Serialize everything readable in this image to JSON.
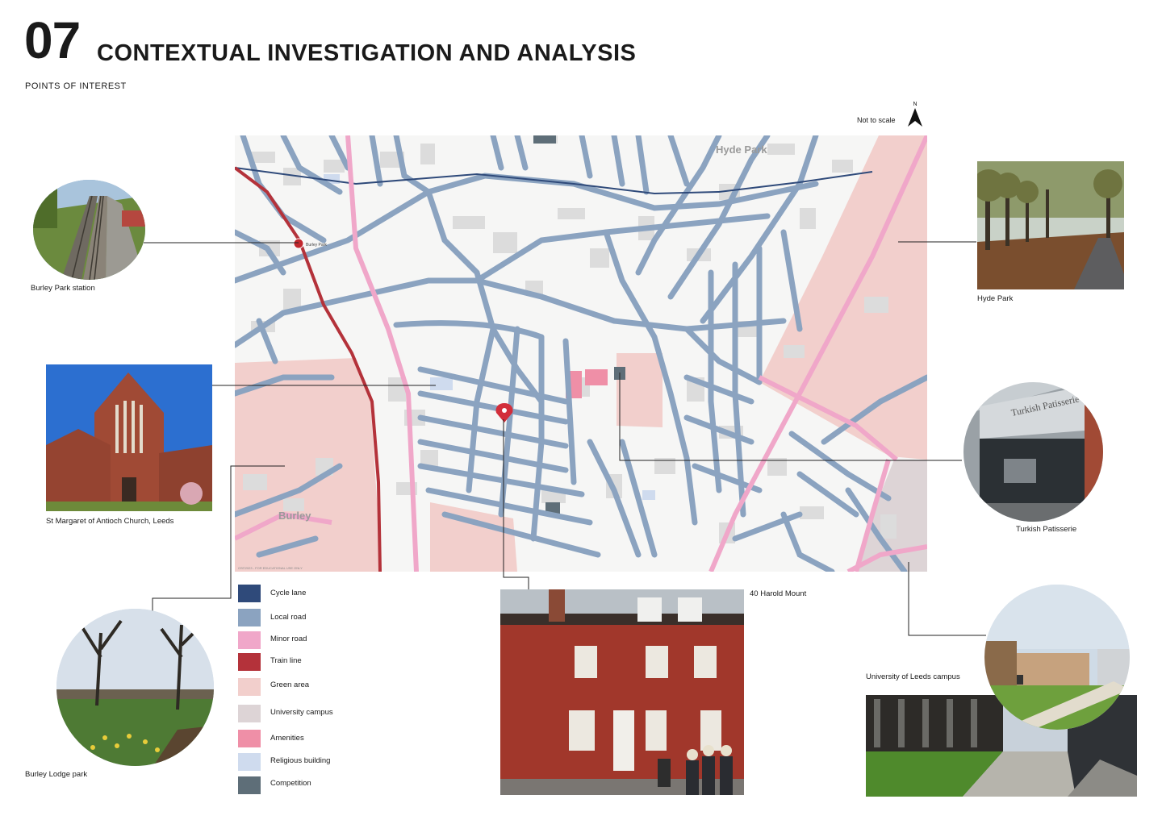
{
  "header": {
    "section_number": "07",
    "title": "CONTEXTUAL INVESTIGATION AND ANALYSIS",
    "subtitle": "POINTS OF INTEREST"
  },
  "map": {
    "scale_note": "Not to scale",
    "north_label": "N",
    "place_labels": {
      "hyde_park": "Hyde Park",
      "burley": "Burley",
      "station": "Burley Park"
    },
    "credit": "OS©2023 - FOR EDUCATIONAL USE ONLY",
    "colors": {
      "cycle_lane": "#2f4a7a",
      "local_road": "#8ba3c0",
      "minor_road": "#f0a7c9",
      "train_line": "#b4323a",
      "green_area": "#f2cfcc",
      "university_campus": "#ddd4d6",
      "amenities": "#ef8fa7",
      "religious_building": "#cfdbee",
      "competition": "#5e6e78",
      "building": "#dcdcdc",
      "background": "#f6f6f5"
    }
  },
  "legend": [
    {
      "key": "cycle_lane",
      "label": "Cycle lane",
      "color": "#2f4a7a"
    },
    {
      "key": "local_road",
      "label": "Local road",
      "color": "#8ba3c0"
    },
    {
      "key": "minor_road",
      "label": "Minor road",
      "color": "#f0a7c9"
    },
    {
      "key": "train_line",
      "label": "Train line",
      "color": "#b4323a"
    },
    {
      "key": "green_area",
      "label": "Green area",
      "color": "#f2cfcc"
    },
    {
      "key": "university_campus",
      "label": "University campus",
      "color": "#ddd4d6"
    },
    {
      "key": "amenities",
      "label": "Amenities",
      "color": "#ef8fa7"
    },
    {
      "key": "religious_building",
      "label": "Religious building",
      "color": "#cfdbee"
    },
    {
      "key": "competition",
      "label": "Competition",
      "color": "#5e6e78"
    }
  ],
  "points_of_interest": {
    "burley_park_station": "Burley Park station",
    "hyde_park": "Hyde Park",
    "st_margaret": "St Margaret of Antioch Church, Leeds",
    "turkish_patisserie": "Turkish Patisserie",
    "harold_mount": "40 Harold Mount",
    "university_campus": "University of Leeds campus",
    "burley_lodge_park": "Burley Lodge park"
  },
  "shop_sign": "Turkish Patisserie"
}
